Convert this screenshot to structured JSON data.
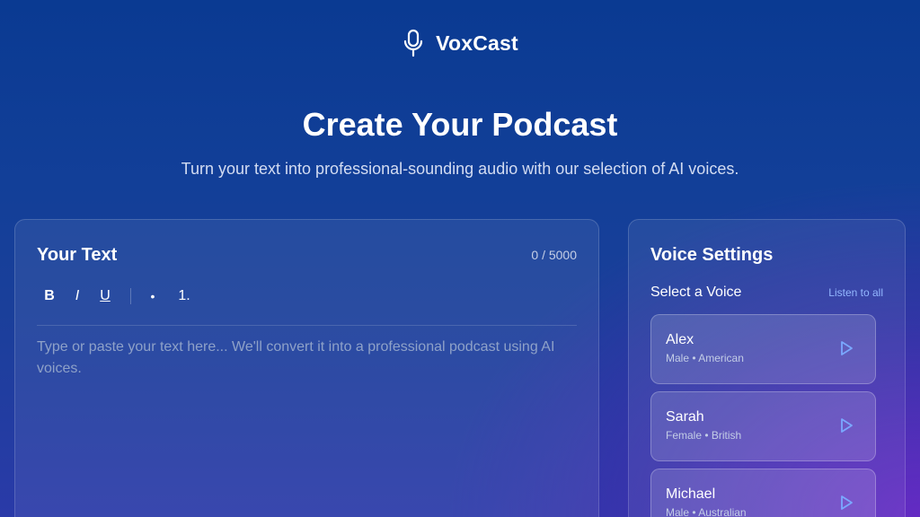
{
  "brand": {
    "name": "VoxCast",
    "icon": "microphone-icon"
  },
  "hero": {
    "title": "Create Your Podcast",
    "subtitle": "Turn your text into professional-sounding audio with our selection of AI voices."
  },
  "text_panel": {
    "title": "Your Text",
    "char_count": "0 / 5000",
    "toolbar": {
      "bold": "B",
      "italic": "I",
      "underline": "U",
      "bullet": "•",
      "numbered": "1."
    },
    "placeholder": "Type or paste your text here... We'll convert it into a professional podcast using AI voices."
  },
  "voice_panel": {
    "title": "Voice Settings",
    "select_label": "Select a Voice",
    "listen_all": "Listen to all",
    "voices": [
      {
        "name": "Alex",
        "meta": "Male • American",
        "icon": "play-icon"
      },
      {
        "name": "Sarah",
        "meta": "Female • British",
        "icon": "play-icon"
      },
      {
        "name": "Michael",
        "meta": "Male • Australian",
        "icon": "play-icon"
      }
    ]
  },
  "colors": {
    "background_top": "#0a3a92",
    "background_accent": "#6e28c8",
    "link": "#93b7ff",
    "placeholder": "#8ea1c8",
    "play_icon": "#7aa8ff"
  }
}
